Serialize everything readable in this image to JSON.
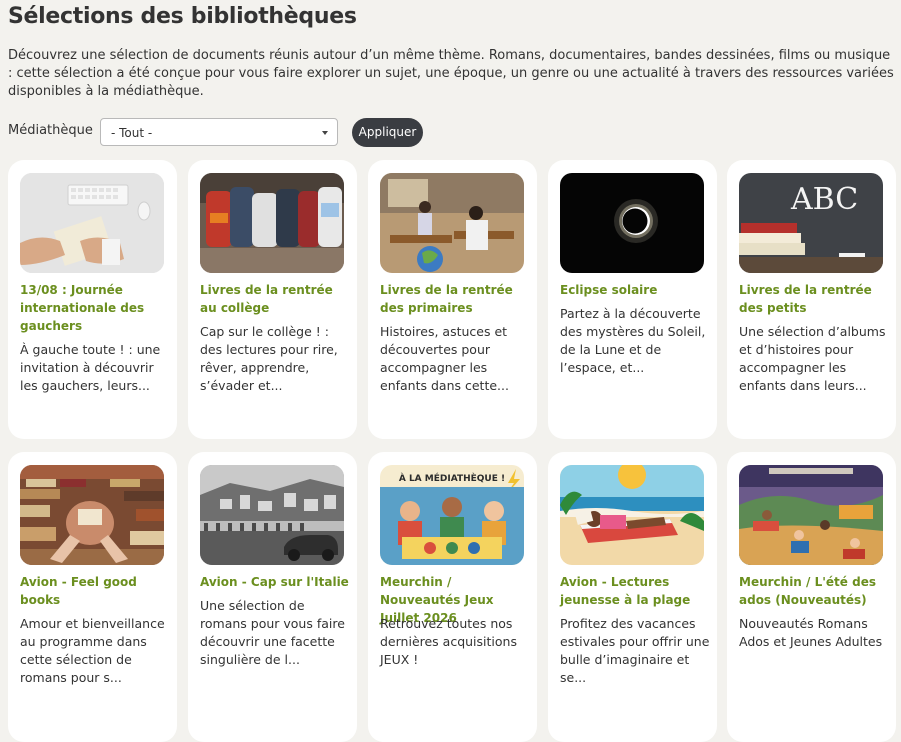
{
  "page": {
    "title": "Sélections des bibliothèques",
    "intro": "Découvrez une sélection de documents réunis autour d’un même thème. Romans, documentaires, bandes dessinées, films ou musique : cette sélection a été conçue pour vous faire explorer un sujet, une époque, un genre ou une actualité à travers des ressources variées disponibles à la médiathèque."
  },
  "filter": {
    "label": "Médiathèque",
    "selected": "- Tout -",
    "apply_label": "Appliquer"
  },
  "cards": [
    {
      "title": "13/08 : Journée internationale des gauchers",
      "description": "À gauche toute ! : une invitation à découvrir les gauchers, leurs...",
      "image": "desk-keyboard-writing"
    },
    {
      "title": "Livres de la rentrée au collège",
      "description": "Cap sur le collège ! : des lectures pour rire, rêver, apprendre, s’évader et...",
      "image": "school-backpacks"
    },
    {
      "title": "Livres de la rentrée des primaires",
      "description": "Histoires, astuces et découvertes pour accompagner les enfants dans cette...",
      "image": "classroom-children"
    },
    {
      "title": "Eclipse solaire",
      "description": "Partez à la découverte des mystères du Soleil, de la Lune et de l’espace, et...",
      "image": "solar-eclipse"
    },
    {
      "title": "Livres de la rentrée des petits",
      "description": "Une sélection d’albums et d’histoires pour accompagner les enfants dans leurs...",
      "image": "chalkboard-abc-books"
    },
    {
      "title": "Avion - Feel good books",
      "description": "Amour et bienveillance au programme dans cette sélection de romans pour s...",
      "image": "reading-among-books"
    },
    {
      "title": "Avion - Cap sur l'Italie",
      "description": "Une sélection de romans pour vous faire découvrir une facette singulière de l...",
      "image": "italian-coast-bw"
    },
    {
      "title": "Meurchin / Nouveautés Jeux Juillet 2026",
      "description": "Retrouvez toutes nos dernières acquisitions JEUX !",
      "image": "board-games-poster",
      "image_text": "À LA MÉDIATHÈQUE !"
    },
    {
      "title": "Avion - Lectures jeunesse à la plage",
      "description": "Profitez des vacances estivales pour offrir une bulle d’imaginaire et se...",
      "image": "beach-reading"
    },
    {
      "title": "Meurchin / L'été des ados (Nouveautés)",
      "description": "Nouveautés Romans Ados et Jeunes Adultes",
      "image": "teens-summer-park"
    }
  ],
  "colors": {
    "background": "#f3f2ee",
    "card_title": "#6b8f1f",
    "button": "#3a3d42"
  }
}
